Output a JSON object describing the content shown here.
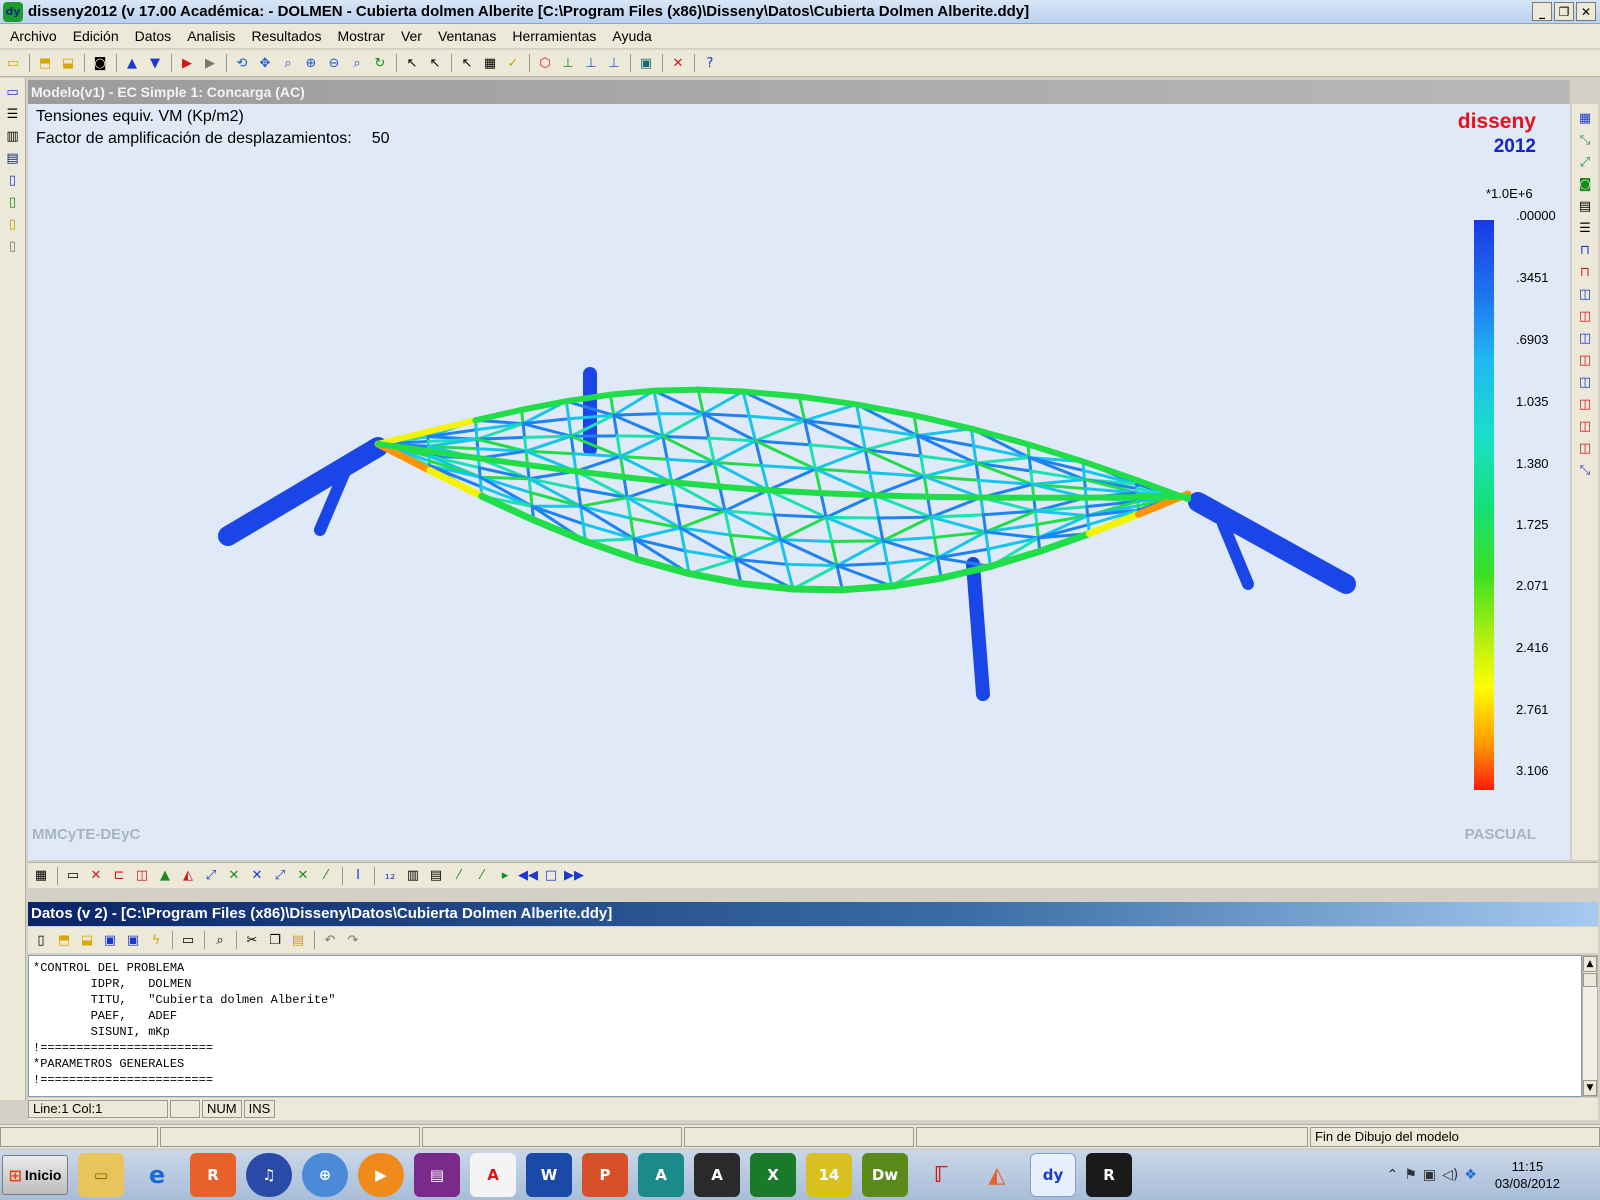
{
  "window": {
    "title": "disseny2012 (v 17.00 Académica: - DOLMEN - Cubierta dolmen Alberite [C:\\Program Files (x86)\\Disseny\\Datos\\Cubierta Dolmen Alberite.ddy]",
    "app_icon": "dy"
  },
  "menu": [
    "Archivo",
    "Edición",
    "Datos",
    "Analisis",
    "Resultados",
    "Mostrar",
    "Ver",
    "Ventanas",
    "Herramientas",
    "Ayuda"
  ],
  "model_window": {
    "title": "Modelo(v1) - EC Simple   1: Concarga (AC)",
    "label_stress": "Tensiones equiv. VM (Kp/m2)",
    "label_factor": "Factor de amplificación de desplazamientos:",
    "factor_value": "50",
    "brand_name": "disseny",
    "brand_year": "2012",
    "footer_left": "MMCyTE-DEyC",
    "footer_right": "PASCUAL"
  },
  "colorbar": {
    "multiplier": "*1.0E+6",
    "ticks": [
      ".00000",
      ".3451",
      ".6903",
      "1.035",
      "1.380",
      "1.725",
      "2.071",
      "2.416",
      "2.761",
      "3.106"
    ]
  },
  "data_window": {
    "title": "Datos (v 2) - [C:\\Program Files (x86)\\Disseny\\Datos\\Cubierta Dolmen Alberite.ddy]",
    "lines": [
      "*CONTROL DEL PROBLEMA",
      "        IDPR,   DOLMEN",
      "        TITU,   \"Cubierta dolmen Alberite\"",
      "        PAEF,   ADEF",
      "        SISUNI, mKp",
      "",
      "!========================",
      "*PARAMETROS GENERALES",
      "!========================"
    ]
  },
  "editor_status": {
    "position": "Line:1  Col:1",
    "num": "NUM",
    "ins": "INS"
  },
  "statusbar": {
    "message": "Fin de Dibujo del modelo"
  },
  "taskbar": {
    "start_label": "Inicio",
    "time": "11:15",
    "date": "03/08/2012"
  },
  "colors": {
    "viewport_bg": "#dfe9f7",
    "brand_red": "#e8101b",
    "brand_blue": "#1524c7"
  }
}
